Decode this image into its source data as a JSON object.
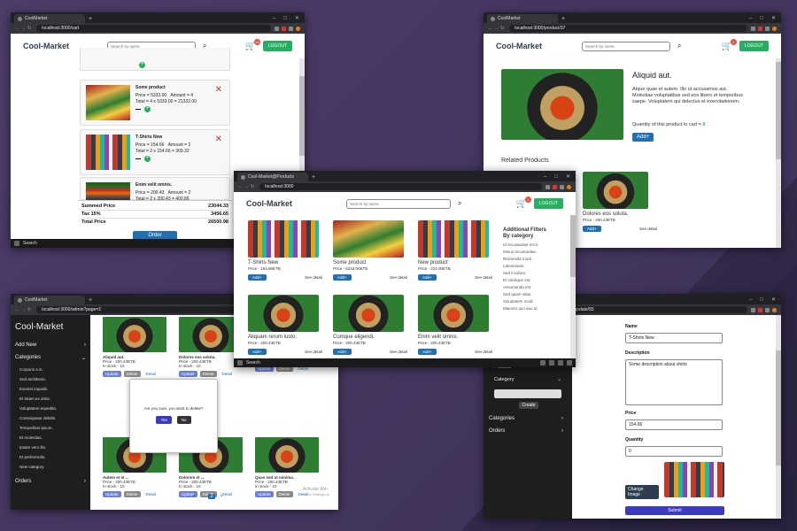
{
  "colors": {
    "accent_green": "#27ae60",
    "accent_blue": "#1f6fb2",
    "delete_red": "#c0392b",
    "background": "#3d2f55"
  },
  "cart_window": {
    "tab_title": "CoolMarket",
    "url": "localhost:3000/cart",
    "logo": "Cool-Market",
    "search_placeholder": "Search by name",
    "cart_count": "16",
    "logout": "LOGOUT",
    "items": [
      {
        "name": "Some product",
        "price": "Price = 5333.00",
        "amount": "Amount = 4",
        "total": "Total = 4 x 5333.00 = 21332.00"
      },
      {
        "name": "T-Shirts New",
        "price": "Price = 154.66",
        "amount": "Amount = 2",
        "total": "Total = 2 x 154.66 = 309.32"
      },
      {
        "name": "Enim velit omnis.",
        "price": "Price = 200.43",
        "amount": "Amount = 2",
        "total": "Total = 2 x 200.43 = 400.86"
      }
    ],
    "summary": {
      "summed_label": "Summed Price",
      "summed_value": "23044.33",
      "tax_label": "Tax 15%",
      "tax_value": "3456.65",
      "total_label": "Total Price",
      "total_value": "26500.98"
    },
    "order_button": "Order",
    "taskbar_search": "Search"
  },
  "product_window": {
    "tab_title": "CoolMarket",
    "url": "localhost:3000/product/37",
    "logo": "Cool-Market",
    "search_placeholder": "Search by name",
    "cart_count": "3",
    "logout": "LOGOUT",
    "title": "Aliquid aut.",
    "description": "Atque quae et autem. Illo ut accusamus aut. Molestiae voluptatibus sed eos libero et temporibus saepe. Voluptatem qui delectus et exercitationem.",
    "quantity_label": "Quantity of this product in cart =",
    "quantity_value": "0",
    "add_button": "Add+",
    "related_heading": "Related Products",
    "related": {
      "name": "Dolores eos soluta.",
      "price": "Price - 200.43ETB",
      "add": "Add+",
      "see": "See detail"
    }
  },
  "products_window": {
    "tab_title": "Cool-Market@Products",
    "url": "localhost:3000",
    "logo": "Cool-Market",
    "search_placeholder": "Search by name",
    "cart_count": "0",
    "logout": "LOGOUT",
    "products": [
      {
        "name": "T-Shirts New",
        "price": "Price - 154.66ETB",
        "add": "Add+",
        "see": "See detail",
        "img": "shirt"
      },
      {
        "name": "Some product",
        "price": "Price - 5333.00ETB",
        "add": "Add+",
        "see": "See detail",
        "img": "gro"
      },
      {
        "name": "New product",
        "price": "Price - 222.00ETB",
        "add": "Add+",
        "see": "See detail",
        "img": "shirt"
      },
      {
        "name": "Aliquam rerum iusto.",
        "price": "Price - 200.43ETB",
        "add": "Add+",
        "see": "See detail",
        "img": "cart"
      },
      {
        "name": "Cumque eligendi.",
        "price": "Price - 200.43ETB",
        "add": "Add+",
        "see": "See detail",
        "img": "cart"
      },
      {
        "name": "Enim velit omnis.",
        "price": "Price - 200.43ETB",
        "add": "Add+",
        "see": "See detail",
        "img": "cart"
      }
    ],
    "filters_heading1": "Additional Filters",
    "filters_heading2": "By category",
    "categories": [
      "Id recusandae error.",
      "Minus recusandae.",
      "Reiciendis modi.",
      "Laboriosam.",
      "Sed incidunt.",
      "Et similique est.",
      "Assumenda est.",
      "Sed quam vitae.",
      "Voluptatem modi.",
      "Maiores quo quo ut."
    ],
    "taskbar_search": "Search"
  },
  "admin_window": {
    "tab_title": "CoolMarket",
    "url": "localhost:3000/admin?page=2",
    "brand": "Cool-Market",
    "add_new": "Add New",
    "categories": "Categories",
    "category_list": [
      "Corporis a in.",
      "Sed architecto.",
      "Eveniet impedit.",
      "Et totam ex dolor.",
      "Voluptatem expedita.",
      "Consequatur debitis.",
      "Temporibus ipsum.",
      "Et molestias.",
      "Ipsam vero illo.",
      "Et perferendis.",
      "New category"
    ],
    "orders": "Orders",
    "cards": [
      {
        "name": "Aliquid aut.",
        "price": "Price - 200.43ETB",
        "stock": "In stock - 10"
      },
      {
        "name": "Dolores eos soluta.",
        "price": "Price - 200.43ETB",
        "stock": "In stock - 10"
      },
      {
        "name": "",
        "price": "",
        "stock": "In stock - 10"
      },
      {
        "name": "Autem et et ...",
        "price": "Price - 200.43ETB",
        "stock": "In stock - 10"
      },
      {
        "name": "Dolorem et ...",
        "price": "Price - 200.43ETB",
        "stock": "In stock - 10"
      },
      {
        "name": "Quas sed ut minima.",
        "price": "Price - 200.43ETB",
        "stock": "In stock - 10"
      }
    ],
    "update": "Update",
    "delete": "Delete",
    "detail": "Detail",
    "modal": {
      "question": "Are you sure, you want to delete?",
      "yes": "Yes",
      "no": "No"
    },
    "pagination": {
      "prev": "‹",
      "page1": "1",
      "page2": "2",
      "next": "›"
    },
    "watermark1": "Activate Win",
    "watermark2": "Go to Settings to"
  },
  "update_window": {
    "url": "/update/55",
    "sidebar": {
      "product": "Product",
      "category": "Category",
      "create": "Create",
      "categories": "Categories",
      "orders": "Orders"
    },
    "name_label": "Name",
    "name_value": "T-Shirts New",
    "description_label": "Description",
    "description_value": "Some description about shirts",
    "price_label": "Price",
    "price_value": "154.66",
    "quantity_label": "Quantity",
    "quantity_value": "0",
    "change_image": "Change Image",
    "submit": "Submit"
  }
}
